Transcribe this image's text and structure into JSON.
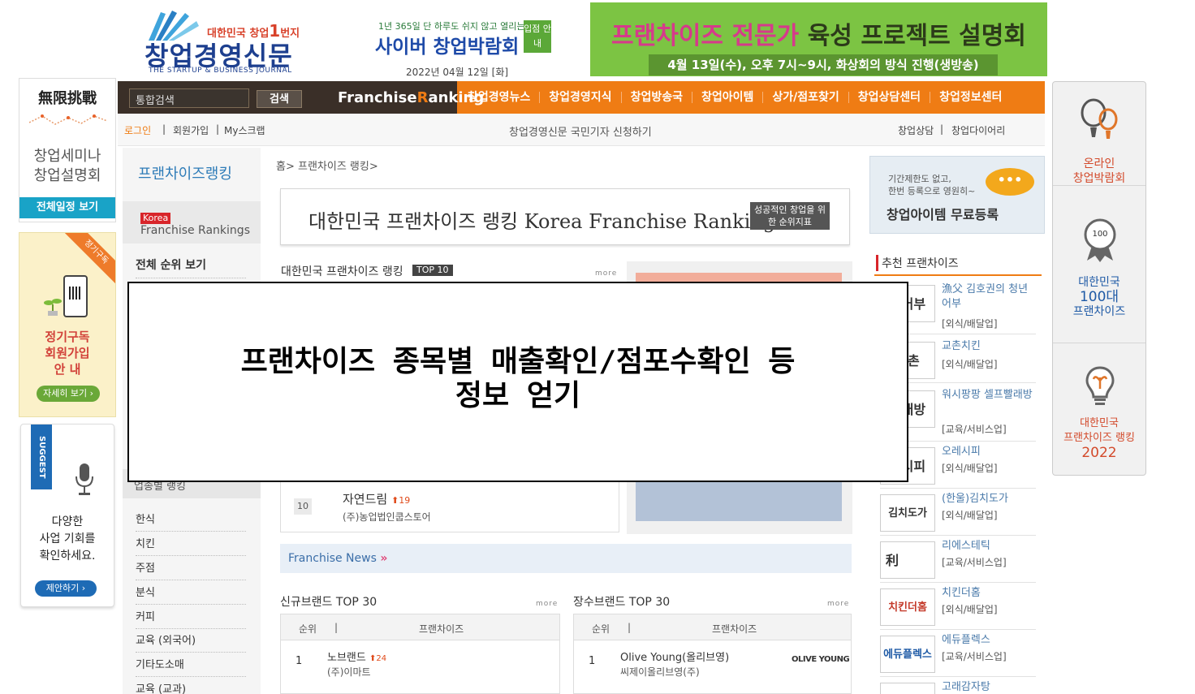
{
  "header": {
    "logo_slogan_prefix": "대한민국 창업",
    "logo_slogan_num": "1",
    "logo_slogan_suffix": "번지",
    "logo_main": "창업경영신문",
    "logo_sub": "THE STARTUP & BUSINESS JOURNAL",
    "expo_top": "1년 365일 단 하루도 쉬지 않고 열리는",
    "expo_main": "사이버 창업박람회",
    "expo_badge": "입점 안내",
    "date": "2022년 04월 12일 [화]",
    "banner_title_highlight": "프랜차이즈 전문가",
    "banner_title_rest": " 육성 프로젝트 설명회",
    "banner_sub": "4월 13일(수), 오후 7시~9시, 화상회의 방식 진행(생방송)"
  },
  "left_ads": {
    "ad1_title": "無限挑戰",
    "ad1_line1": "창업세미나",
    "ad1_line2": "창업설명회",
    "ad1_button": "전체일정 보기",
    "ad2_ribbon": "정기구독",
    "ad2_line1": "정기구독",
    "ad2_line2": "회원가입",
    "ad2_line3": "안    내",
    "ad2_button": "자세히 보기 ›",
    "ad3_tag": "SUGGEST",
    "ad3_line1": "다양한",
    "ad3_line2": "사업 기회를",
    "ad3_line3": "확인하세요.",
    "ad3_button": "제안하기 ›"
  },
  "right_ads": {
    "item1_l1": "온라인",
    "item1_l2": "창업박람회",
    "item2_badge": "100",
    "item2_l1": "대한민국",
    "item2_l2": "100대",
    "item2_l3": "프랜차이즈",
    "item3_l1": "대한민국",
    "item3_l2": "프랜차이즈 랭킹",
    "item3_l3": "2022"
  },
  "nav": {
    "search_placeholder": "통합검색",
    "search_button": "검색",
    "fr_rank_a": "Franchise",
    "fr_rank_b": "R",
    "fr_rank_c": "anking",
    "menu": [
      "창업경영뉴스",
      "창업경영지식",
      "창업방송국",
      "창업아이템",
      "상가/점포찾기",
      "창업상담센터",
      "창업정보센터"
    ]
  },
  "subbar": {
    "login": "로그인",
    "join": "회원가입",
    "scrap": "My스크랩",
    "center": "창업경영신문 국민기자 신청하기",
    "consult": "창업상담",
    "diary": "창업다이어리"
  },
  "sidebar": {
    "title": "프랜차이즈랭킹",
    "korea_tag": "Korea",
    "fr_rankings": "Franchise Rankings",
    "all_rank": "전체 순위 보기",
    "sub_header": "업종별 랭킹",
    "items": [
      "한식",
      "치킨",
      "주점",
      "분식",
      "커피",
      "교육 (외국어)",
      "기타도소매",
      "교육 (교과)"
    ]
  },
  "main": {
    "breadcrumb": "홈> 프랜차이즈 랭킹>",
    "banner_title": "대한민국 프랜차이즈 랭킹 Korea Franchise Rankings",
    "banner_badge": "성공적인 창업을 위한 순위지표",
    "top10_title": "대한민국 프랜차이즈 랭킹",
    "top10_badge": "TOP 10",
    "more": "more",
    "rank10_num": "10",
    "rank10_name": "자연드림",
    "rank10_up": "⬆19",
    "rank10_co": "(주)농업법인쿱스토어",
    "news_title": "Franchise News",
    "news_arrow": "»",
    "new_brand_title": "신규브랜드 TOP 30",
    "long_brand_title": "장수브랜드 TOP 30",
    "col_rank": "순위",
    "col_sep": "|",
    "col_fr": "프랜차이즈",
    "new_row_num": "1",
    "new_row_name": "노브랜드",
    "new_row_up": "⬆24",
    "new_row_co": "(주)이마트",
    "long_row_num": "1",
    "long_row_name": "Olive Young(올리브영)",
    "long_row_co": "씨제이올리브영(주)",
    "long_row_logo": "OLIVE YOUNG"
  },
  "right_col": {
    "reg_s1": "기간제한도 없고,",
    "reg_s2": "한번 등록으로 영원히~",
    "reg_title": "창업아이템 무료등록",
    "reg_bubble": "•••",
    "rec_title": "추천 프랜차이즈",
    "items": [
      {
        "name": "漁父 김호권의 청년어부",
        "cat": "[외식/배달업]",
        "thumb": "년어부"
      },
      {
        "name": "교촌치킨",
        "cat": "[외식/배달업]",
        "thumb": "교촌"
      },
      {
        "name": "워시팡팡 셀프빨래방",
        "cat": "[교육/서비스업]",
        "thumb": "빨래방"
      },
      {
        "name": "오레시피",
        "cat": "[외식/배달업]",
        "thumb": "레시피"
      },
      {
        "name": "(한울)김치도가",
        "cat": "[외식/배달업]",
        "thumb": "김치도가"
      },
      {
        "name": "리에스테틱",
        "cat": "[교육/서비스업]",
        "thumb": "利"
      },
      {
        "name": "치킨더홈",
        "cat": "[외식/배달업]",
        "thumb": "치킨더홈"
      },
      {
        "name": "에듀플렉스",
        "cat": "[교육/서비스업]",
        "thumb": "에듀플렉스"
      },
      {
        "name": "고래감자탕",
        "cat": "",
        "thumb": ""
      }
    ]
  },
  "overlay": {
    "line1": "프랜차이즈 종목별 매출확인/점포수확인 등",
    "line2": "정보 얻기"
  }
}
